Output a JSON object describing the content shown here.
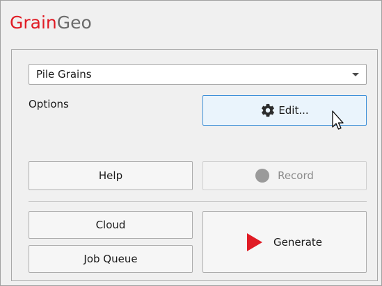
{
  "app": {
    "title_part1": "Grain",
    "title_part2": "Geo",
    "brand_color": "#e01b24",
    "title_secondary_color": "#6b6b6b"
  },
  "preset": {
    "selected": "Pile Grains"
  },
  "options": {
    "label": "Options",
    "edit_label": "Edit..."
  },
  "actions": {
    "help_label": "Help",
    "record_label": "Record",
    "cloud_label": "Cloud",
    "job_queue_label": "Job Queue",
    "generate_label": "Generate"
  },
  "icons": {
    "edit": "gear-icon",
    "record": "record-dot-icon",
    "generate": "play-icon",
    "dropdown": "chevron-down-icon",
    "pointer": "mouse-cursor-icon"
  }
}
